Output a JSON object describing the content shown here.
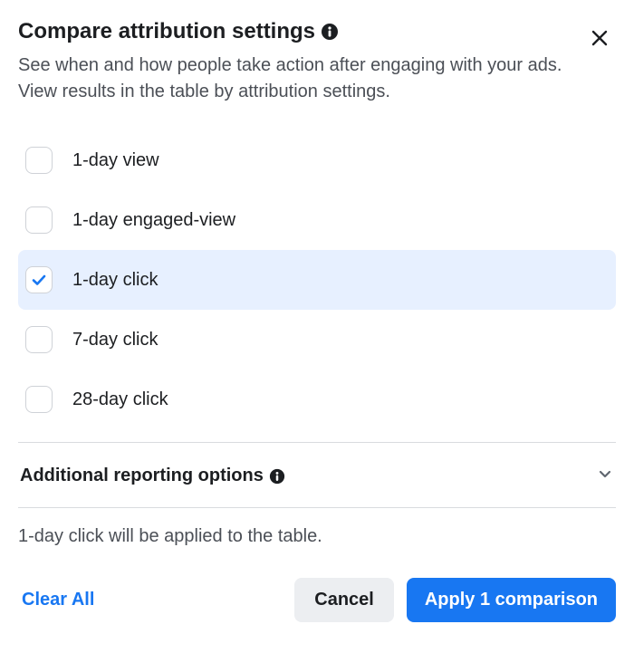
{
  "header": {
    "title": "Compare attribution settings",
    "subtitle": "See when and how people take action after engaging with your ads. View results in the table by attribution settings."
  },
  "options": [
    {
      "label": "1-day view",
      "selected": false
    },
    {
      "label": "1-day engaged-view",
      "selected": false
    },
    {
      "label": "1-day click",
      "selected": true
    },
    {
      "label": "7-day click",
      "selected": false
    },
    {
      "label": "28-day click",
      "selected": false
    }
  ],
  "section": {
    "title": "Additional reporting options",
    "expanded": false
  },
  "applied_text": "1-day click will be applied to the table.",
  "footer": {
    "clear_label": "Clear All",
    "cancel_label": "Cancel",
    "apply_label": "Apply 1 comparison"
  },
  "icons": {
    "info": "info-icon",
    "close": "close-icon",
    "chevron_down": "chevron-down-icon",
    "check": "check-icon"
  }
}
